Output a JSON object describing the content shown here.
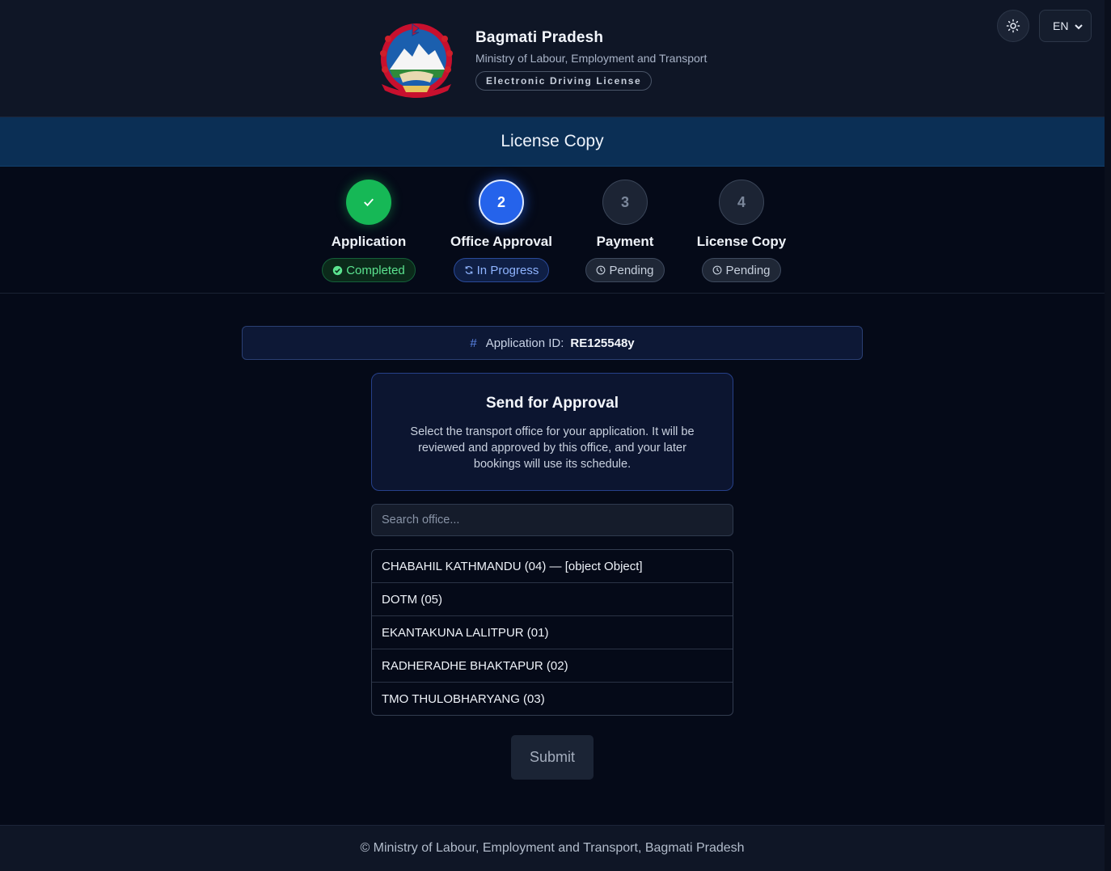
{
  "header": {
    "title": "Bagmati Pradesh",
    "subtitle": "Ministry of Labour, Employment and Transport",
    "badge": "Electronic Driving License",
    "theme_toggle_icon": "sun-icon",
    "language": {
      "selected": "EN",
      "options": [
        "EN"
      ]
    }
  },
  "page_title": "License Copy",
  "steps": [
    {
      "number": "✓",
      "label": "Application",
      "status": "Completed",
      "state": "done",
      "status_icon": "check-circle-icon"
    },
    {
      "number": "2",
      "label": "Office Approval",
      "status": "In Progress",
      "state": "active",
      "status_icon": "refresh-icon"
    },
    {
      "number": "3",
      "label": "Payment",
      "status": "Pending",
      "state": "pending",
      "status_icon": "clock-icon"
    },
    {
      "number": "4",
      "label": "License Copy",
      "status": "Pending",
      "state": "pending",
      "status_icon": "clock-icon"
    }
  ],
  "application": {
    "hash_symbol": "#",
    "id_label": "Application ID:",
    "id_value": "RE125548y"
  },
  "approval": {
    "title": "Send for Approval",
    "description": "Select the transport office for your application. It will be reviewed and approved by this office, and your later bookings will use its schedule."
  },
  "search": {
    "placeholder": "Search office...",
    "value": ""
  },
  "offices": [
    "CHABAHIL KATHMANDU (04) — [object Object]",
    "DOTM (05)",
    "EKANTAKUNA LALITPUR (01)",
    "RADHERADHE BHAKTAPUR (02)",
    "TMO THULOBHARYANG (03)"
  ],
  "submit_label": "Submit",
  "footer": "© Ministry of Labour, Employment and Transport, Bagmati Pradesh",
  "colors": {
    "background": "#050a18",
    "header": "#0f1626",
    "title_bar": "#0b2f55",
    "step_done": "#16b856",
    "step_active": "#2563eb",
    "accent_border": "#26408a"
  }
}
